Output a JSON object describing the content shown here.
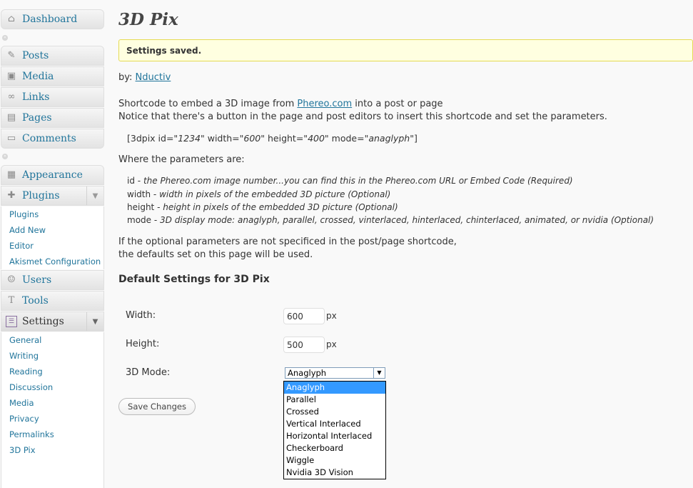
{
  "sidebar": {
    "dashboard": {
      "label": "Dashboard",
      "icon": "dashboard-icon"
    },
    "posts": {
      "label": "Posts",
      "icon": "pushpin-icon"
    },
    "media": {
      "label": "Media",
      "icon": "media-icon"
    },
    "links": {
      "label": "Links",
      "icon": "link-icon"
    },
    "pages": {
      "label": "Pages",
      "icon": "pages-icon"
    },
    "comments": {
      "label": "Comments",
      "icon": "comment-icon"
    },
    "appearance": {
      "label": "Appearance",
      "icon": "appearance-icon"
    },
    "plugins": {
      "label": "Plugins",
      "icon": "plugin-icon"
    },
    "plugins_sub": [
      "Plugins",
      "Add New",
      "Editor",
      "Akismet Configuration"
    ],
    "users": {
      "label": "Users",
      "icon": "users-icon"
    },
    "tools": {
      "label": "Tools",
      "icon": "tools-icon"
    },
    "settings": {
      "label": "Settings",
      "icon": "settings-icon"
    },
    "settings_sub": [
      "General",
      "Writing",
      "Reading",
      "Discussion",
      "Media",
      "Privacy",
      "Permalinks",
      "3D Pix"
    ]
  },
  "main": {
    "title": "3D Pix",
    "notice": "Settings saved.",
    "by_prefix": "by:",
    "author_link": "Nductiv",
    "desc_prefix": "Shortcode to embed a 3D image from",
    "desc_link": "Phereo.com",
    "desc_suffix": "into a post or page",
    "desc2": "Notice that there's a button in the page and post editors to insert this shortcode and set the parameters.",
    "shortcode": {
      "p1": "[3dpix id=\"",
      "id": "1234",
      "p2": "\" width=\"",
      "width": "600",
      "p3": "\" height=\"",
      "height": "400",
      "p4": "\" mode=\"",
      "mode": "anaglyph",
      "p5": "\"]"
    },
    "params_intro": "Where the parameters are:",
    "params": [
      {
        "name": "id -",
        "desc": "the Phereo.com image number...you can find this in the Phereo.com URL or Embed Code (Required)"
      },
      {
        "name": "width -",
        "desc": "width in pixels of the embedded 3D picture (Optional)"
      },
      {
        "name": "height -",
        "desc": "height in pixels of the embedded 3D picture (Optional)"
      },
      {
        "name": "mode -",
        "desc": "3D display mode: anaglyph, parallel, crossed, vinterlaced, hinterlaced, chinterlaced, animated, or nvidia (Optional)"
      }
    ],
    "optional_note1": "If the optional parameters are not specificed in the post/page shortcode,",
    "optional_note2": "the defaults set on this page will be used.",
    "section_title": "Default Settings for 3D Pix",
    "form": {
      "width_label": "Width:",
      "width_value": "600",
      "height_label": "Height:",
      "height_value": "500",
      "unit": "px",
      "mode_label": "3D Mode:",
      "mode_value": "Anaglyph",
      "mode_options": [
        "Anaglyph",
        "Parallel",
        "Crossed",
        "Vertical Interlaced",
        "Horizontal Interlaced",
        "Checkerboard",
        "Wiggle",
        "Nvidia 3D Vision"
      ],
      "save_label": "Save Changes"
    }
  },
  "colors": {
    "link": "#21759b",
    "notice_bg": "#ffffe0",
    "notice_border": "#e6db55",
    "selected_option": "#3399ff",
    "current_menu": "#6d6d6d"
  }
}
